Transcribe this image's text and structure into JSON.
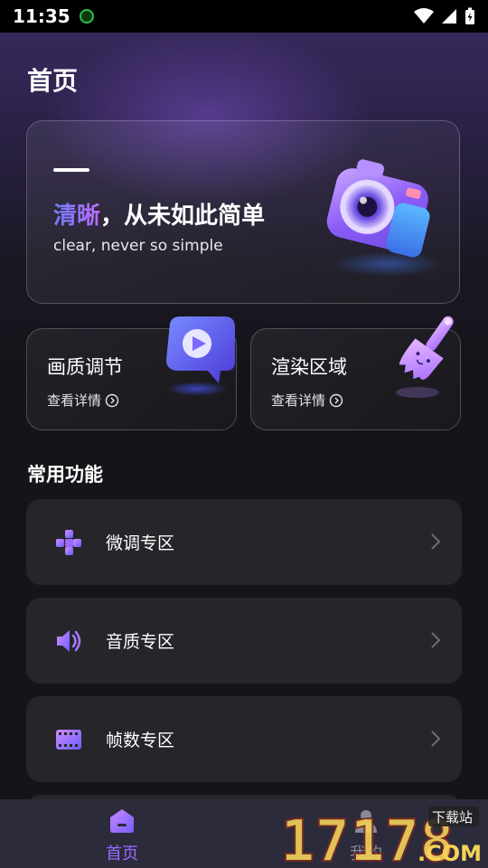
{
  "status_bar": {
    "time": "11:35"
  },
  "page": {
    "title": "首页"
  },
  "hero": {
    "headline_accent": "清晰",
    "headline_rest": "，从未如此简单",
    "subtitle": "clear, never so simple",
    "icon": "camera-icon"
  },
  "cards": [
    {
      "title": "画质调节",
      "link": "查看详情",
      "icon": "play-bubble-icon"
    },
    {
      "title": "渲染区域",
      "link": "查看详情",
      "icon": "paint-brush-icon"
    }
  ],
  "section": {
    "title": "常用功能"
  },
  "features": [
    {
      "label": "微调专区",
      "icon": "tune-blocks-icon"
    },
    {
      "label": "音质专区",
      "icon": "speaker-icon"
    },
    {
      "label": "帧数专区",
      "icon": "film-icon"
    }
  ],
  "bottom_nav": {
    "tabs": [
      {
        "label": "首页",
        "icon": "home-icon",
        "active": true
      },
      {
        "label": "我的",
        "icon": "profile-icon",
        "active": false
      }
    ]
  },
  "watermark": {
    "text": "17178",
    "sub": "下载站",
    "domain": ".COM"
  },
  "colors": {
    "accent": "#8a6bff",
    "active_tab": "#9b6bff",
    "card_bg": "#25252a",
    "nav_bg": "#2c2b3c"
  }
}
